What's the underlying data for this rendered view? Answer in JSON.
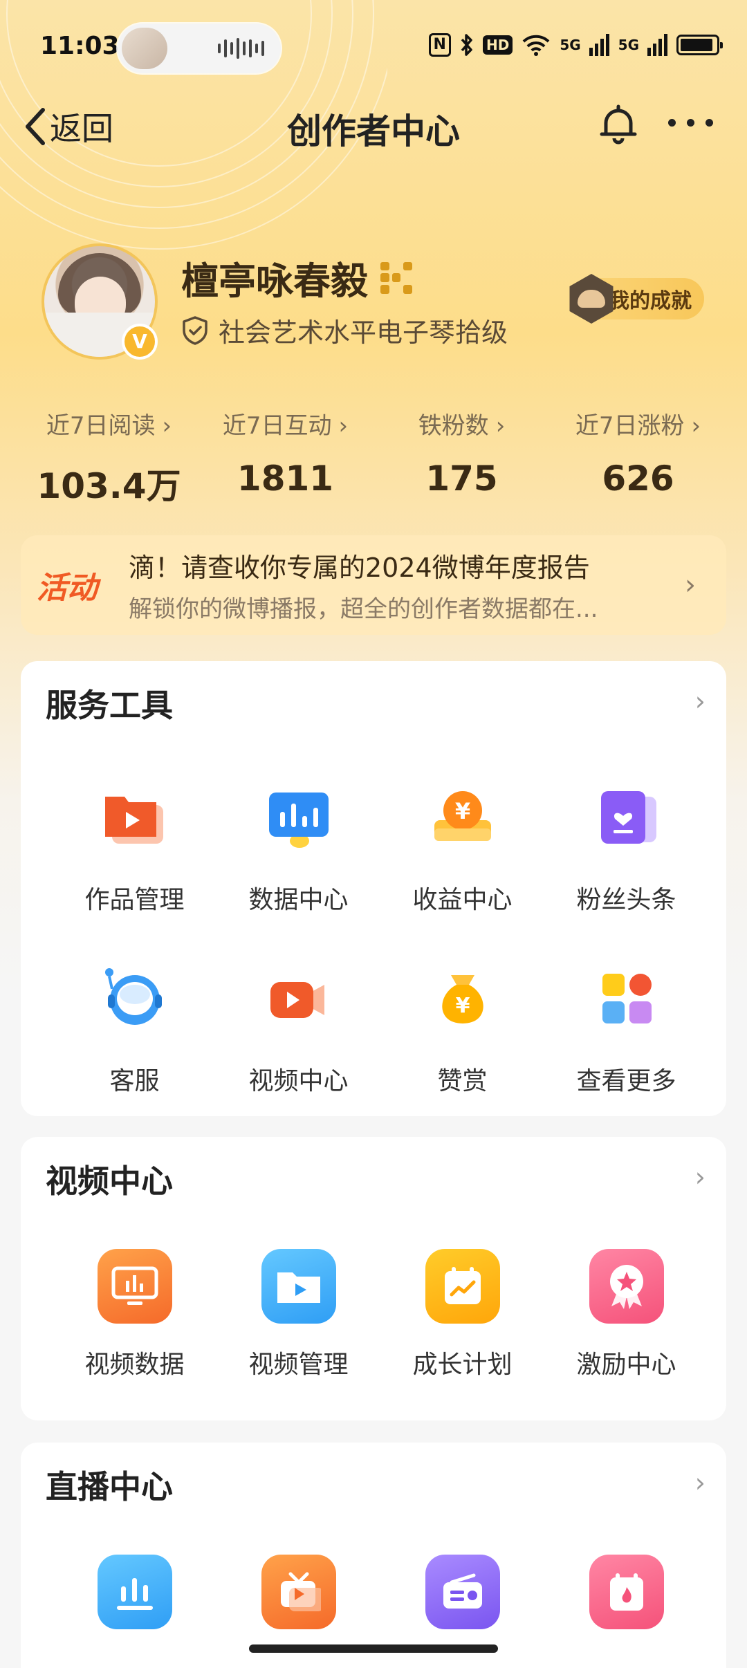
{
  "status_bar": {
    "time": "11:03",
    "nfc": "N",
    "bluetooth_icon": "bluetooth-icon",
    "hd": "HD",
    "net1": "5G",
    "net2": "5G"
  },
  "nav": {
    "back_label": "返回",
    "title": "创作者中心"
  },
  "profile": {
    "name": "檀亭咏春毅",
    "cert": "社会艺术水平电子琴拾级",
    "verified_badge": "V",
    "achievement_label": "我的成就"
  },
  "stats": [
    {
      "label": "近7日阅读",
      "value": "103.4万"
    },
    {
      "label": "近7日互动",
      "value": "1811"
    },
    {
      "label": "铁粉数",
      "value": "175"
    },
    {
      "label": "近7日涨粉",
      "value": "626"
    }
  ],
  "banner": {
    "tag": "活动",
    "line1": "滴！请查收你专属的2024微博年度报告",
    "line2": "解锁你的微博播报，超全的创作者数据都在..."
  },
  "service_tools": {
    "title": "服务工具",
    "items": [
      {
        "label": "作品管理",
        "icon": "works-icon"
      },
      {
        "label": "数据中心",
        "icon": "data-center-icon"
      },
      {
        "label": "收益中心",
        "icon": "income-icon"
      },
      {
        "label": "粉丝头条",
        "icon": "fans-headline-icon"
      },
      {
        "label": "客服",
        "icon": "customer-service-icon"
      },
      {
        "label": "视频中心",
        "icon": "video-center-icon"
      },
      {
        "label": "赞赏",
        "icon": "reward-icon"
      },
      {
        "label": "查看更多",
        "icon": "more-apps-icon"
      }
    ]
  },
  "video_center": {
    "title": "视频中心",
    "items": [
      {
        "label": "视频数据",
        "icon": "video-data-icon"
      },
      {
        "label": "视频管理",
        "icon": "video-manage-icon"
      },
      {
        "label": "成长计划",
        "icon": "growth-plan-icon"
      },
      {
        "label": "激励中心",
        "icon": "incentive-icon"
      }
    ]
  },
  "live_center": {
    "title": "直播中心",
    "items": [
      {
        "icon": "live-data-icon"
      },
      {
        "icon": "live-tv-icon"
      },
      {
        "icon": "radio-icon"
      },
      {
        "icon": "live-calendar-icon"
      }
    ]
  },
  "colors": {
    "accent_orange": "#f05a24",
    "gold": "#f9b82d",
    "text_dark": "#3a2a14"
  }
}
